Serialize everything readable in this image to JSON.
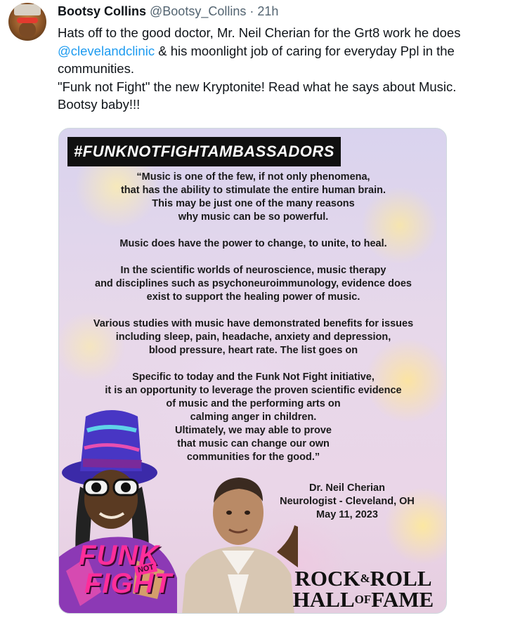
{
  "author": {
    "display_name": "Bootsy Collins",
    "handle": "@Bootsy_Collins",
    "separator": "·",
    "timestamp": "21h"
  },
  "tweet": {
    "line1": "Hats off to the good doctor, Mr. Neil Cherian for the Grt8 work he does",
    "mention": "@clevelandclinic",
    "line2_rest": " & his moonlight job of caring for everyday Ppl in the",
    "line3": "communities.",
    "line4": "\"Funk not Fight\" the new Kryptonite! Read what he says about Music.",
    "line5": "Bootsy baby!!!"
  },
  "media": {
    "hashtag": "#FUNKNOTFIGHTAMBASSADORS",
    "quote_paragraphs": [
      [
        "“Music is one of the few, if not only phenomena,",
        "that has the ability to stimulate the entire human brain.",
        "This may be just one of the many reasons",
        "why music can be so powerful."
      ],
      [
        "Music does have the power to change, to unite, to heal."
      ],
      [
        "In the scientific worlds of neuroscience, music therapy",
        "and disciplines such as psychoneuroimmunology, evidence does",
        "exist to support the healing power of music."
      ],
      [
        "Various studies with music have demonstrated benefits for issues",
        "including sleep, pain, headache, anxiety and depression,",
        "blood pressure, heart rate.  The list goes on"
      ],
      [
        "Specific to today and the Funk Not Fight initiative,",
        "it is an opportunity to leverage the proven scientific evidence",
        "of music and the performing arts on",
        "calming anger in children.",
        "Ultimately, we may able to prove",
        "that music can change our own",
        "communities for the good.”"
      ]
    ],
    "signature": {
      "name": "Dr. Neil Cherian",
      "title": "Neurologist - Cleveland, OH",
      "date": "May 11, 2023"
    },
    "funk_logo": {
      "word1": "FUNK",
      "not": "NOT",
      "word2": "FIGHT"
    },
    "rrhof": {
      "rock": "ROCK",
      "amp": "&",
      "roll": "ROLL",
      "hall": "HALL",
      "of": "OF",
      "fame": "FAME"
    }
  },
  "colors": {
    "link": "#1d9bf0",
    "secondary_text": "#536471",
    "banner_bg": "#101010",
    "funk_pink": "#ff2d9a"
  }
}
